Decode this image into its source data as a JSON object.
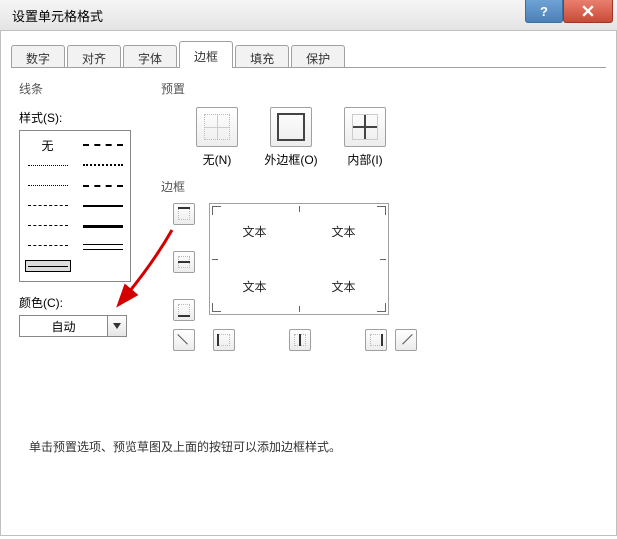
{
  "window": {
    "title": "设置单元格格式"
  },
  "tabs": {
    "number": "数字",
    "align": "对齐",
    "font": "字体",
    "border": "边框",
    "fill": "填充",
    "protect": "保护"
  },
  "line": {
    "group": "线条",
    "style_label": "样式(S):",
    "none": "无",
    "color_label": "颜色(C):",
    "color_value": "自动"
  },
  "presets": {
    "group": "预置",
    "none": {
      "label": "无(N)"
    },
    "outline": {
      "label": "外边框(O)"
    },
    "inside": {
      "label": "内部(I)"
    }
  },
  "border": {
    "group": "边框"
  },
  "preview": {
    "cells": [
      "文本",
      "文本",
      "文本",
      "文本"
    ]
  },
  "hint": "单击预置选项、预览草图及上面的按钮可以添加边框样式。"
}
